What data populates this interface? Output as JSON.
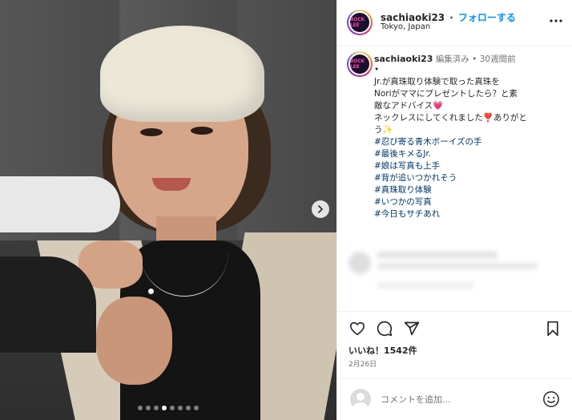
{
  "post": {
    "username": "sachiaoki23",
    "separator": "•",
    "follow_label": "フォローする",
    "location": "Tokyo, Japan",
    "avatar_logo": "ROCK LEE",
    "more_icon": "more-horizontal-icon",
    "image_count": 8,
    "active_image_index": 3
  },
  "caption": {
    "username": "sachiaoki23",
    "edited": "編集済み",
    "separator": "•",
    "time_ago": "30週間前",
    "bullet": "•",
    "lines": [
      "Jr.が真珠取り体験で取った真珠を",
      "Noriがママにプレゼントしたら？と素",
      "敵なアドバイス💗",
      "ネックレスにしてくれました❣️ありがと",
      "う✨"
    ],
    "hashtags": [
      "#忍び寄る青木ボーイズの手",
      "#最後キメるJr.",
      "#娘は写真も上手",
      "#背が追いつかれそう",
      "#真珠取り体験",
      "#いつかの写真",
      "#今日もサチあれ"
    ]
  },
  "actions": {
    "like_icon": "heart-icon",
    "comment_icon": "comment-icon",
    "share_icon": "share-icon",
    "save_icon": "bookmark-icon",
    "likes_text": "いいね！1542件",
    "date_text": "2月26日"
  },
  "comment_box": {
    "placeholder": "コメントを追加...",
    "emoji_icon": "emoji-icon"
  },
  "colors": {
    "accent_blue": "#0095f6",
    "hashtag": "#00376b",
    "muted": "#737373"
  }
}
